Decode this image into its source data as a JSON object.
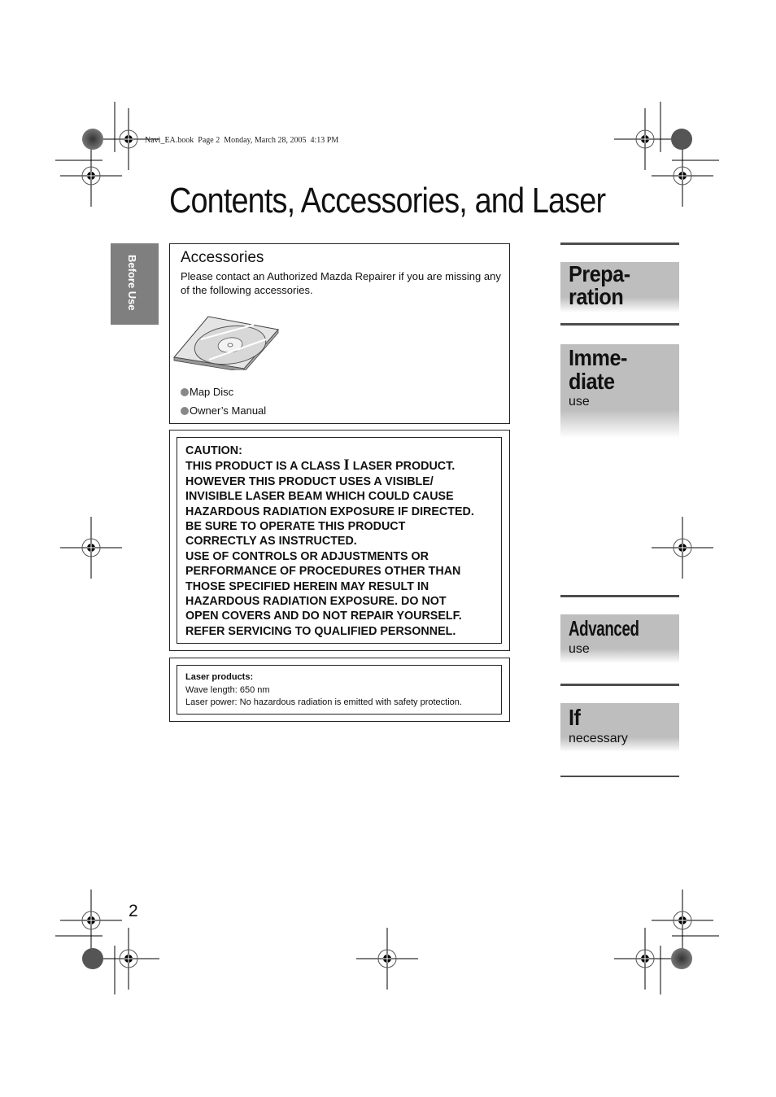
{
  "header_stamp": "Navi_EA.book  Page 2  Monday, March 28, 2005  4:13 PM",
  "page_title": "Contents, Accessories, and Laser",
  "side_tab": "Before Use",
  "accessories": {
    "title": "Accessories",
    "description": "Please contact an Authorized Mazda Repairer if you are missing any of the following accessories.",
    "image": "cd-case-icon",
    "items": [
      "Map Disc",
      "Owner’s Manual"
    ]
  },
  "caution": {
    "lines": [
      "CAUTION:",
      "THIS PRODUCT IS A CLASS ",
      "I",
      " LASER PRODUCT.",
      "HOWEVER THIS PRODUCT USES A VISIBLE/",
      "INVISIBLE LASER BEAM WHICH COULD CAUSE",
      "HAZARDOUS RADIATION EXPOSURE IF DIRECTED.",
      "BE SURE TO OPERATE THIS PRODUCT",
      "CORRECTLY AS INSTRUCTED.",
      "USE OF CONTROLS OR ADJUSTMENTS OR",
      "PERFORMANCE OF PROCEDURES OTHER THAN",
      "THOSE SPECIFIED HEREIN MAY RESULT IN",
      "HAZARDOUS RADIATION EXPOSURE. DO NOT",
      "OPEN COVERS AND DO NOT REPAIR YOURSELF.",
      "REFER SERVICING TO QUALIFIED PERSONNEL."
    ]
  },
  "laser": {
    "heading": "Laser products:",
    "wave_length": "Wave length: 650 nm",
    "power": "Laser power: No hazardous radiation is emitted with safety protection."
  },
  "sections": [
    {
      "big1": "Prepa-",
      "big2": "ration",
      "small": ""
    },
    {
      "big1": "Imme-",
      "big2": "diate",
      "small": "use"
    },
    {
      "big1": "Advanced",
      "big2": "",
      "small": "use"
    },
    {
      "big1": "If",
      "big2": "",
      "small": "necessary"
    }
  ],
  "page_number": "2",
  "colors": {
    "side_tab": "#7f7f7f",
    "section_panel": "#bebebe",
    "section_rule": "#4d4d4d",
    "bullet": "#888888"
  }
}
